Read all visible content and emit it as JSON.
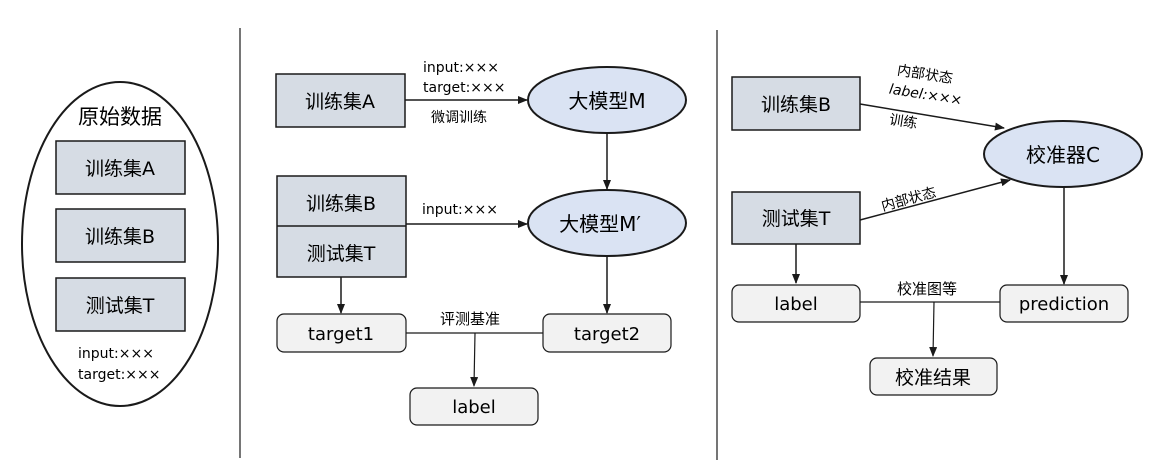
{
  "panel1": {
    "title": "原始数据",
    "boxes": [
      "训练集A",
      "训练集B",
      "测试集T"
    ],
    "note_line1": "input:×××",
    "note_line2": "target:×××"
  },
  "panel2": {
    "train_a": "训练集A",
    "train_b": "训练集B",
    "test_t": "测试集T",
    "model_m": "大模型M",
    "model_m_prime": "大模型M′",
    "edge1_line1": "input:×××",
    "edge1_line2": "target:×××",
    "edge1_below": "微调训练",
    "edge2_label": "input:×××",
    "target1": "target1",
    "target2": "target2",
    "eval_label": "评测基准",
    "label_box": "label"
  },
  "panel3": {
    "train_b": "训练集B",
    "test_t": "测试集T",
    "calibrator": "校准器C",
    "edge1_line1": "内部状态",
    "edge1_line2": "label:×××",
    "edge1_below": "训练",
    "edge2_label": "内部状态",
    "label_box": "label",
    "prediction_box": "prediction",
    "calib_label": "校准图等",
    "result_box": "校准结果"
  },
  "colors": {
    "box_fill": "#d6dce4",
    "ellipse_fill": "#dae3f3",
    "output_fill": "#f2f2f2",
    "stroke": "#1a1a1a"
  }
}
